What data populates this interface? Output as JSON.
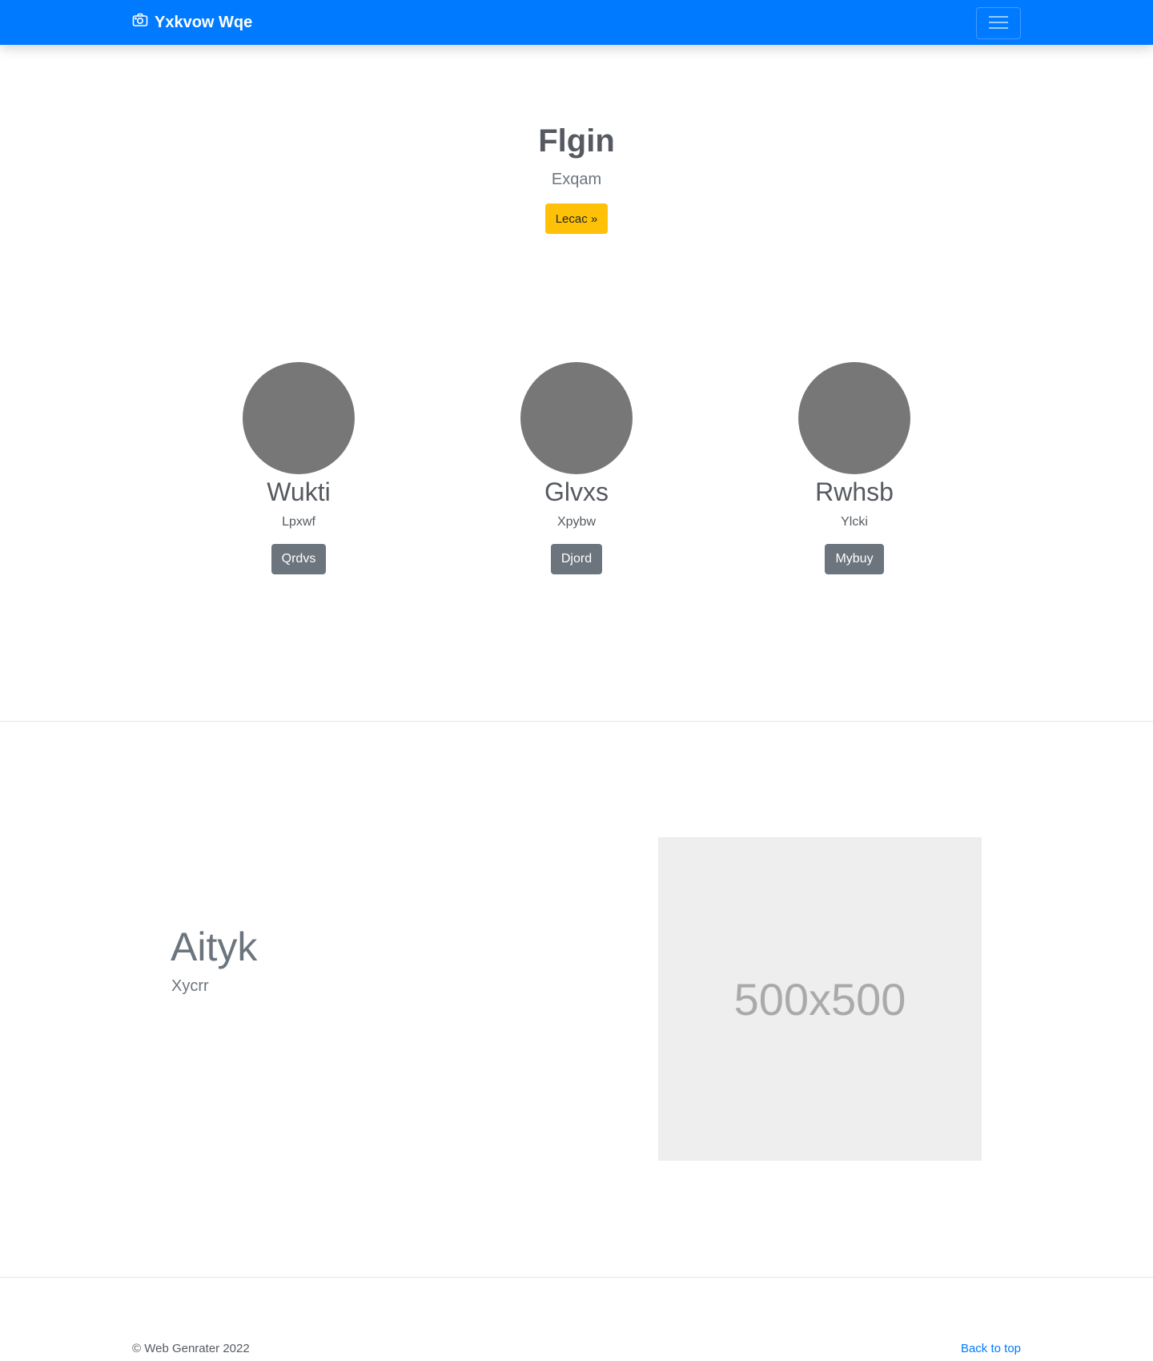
{
  "navbar": {
    "brand_icon": "camera-icon",
    "brand": "Yxkvow Wqe",
    "toggler_icon": "hamburger-menu-icon",
    "color": "#007bff"
  },
  "hero": {
    "heading": "Flgin",
    "lead": "Exqam",
    "button": "Lecac »",
    "button_color": "#ffc107"
  },
  "columns": [
    {
      "heading": "Wukti",
      "text": "Lpxwf",
      "button": "Qrdvs"
    },
    {
      "heading": "Glvxs",
      "text": "Xpybw",
      "button": "Djord"
    },
    {
      "heading": "Rwhsb",
      "text": "Ylcki",
      "button": "Mybuy"
    }
  ],
  "feature": {
    "heading": "Aityk",
    "subheading": "Xycrr",
    "image_label": "500x500"
  },
  "footer": {
    "copyright": "© Web Genrater 2022",
    "back_to_top": "Back to top"
  }
}
